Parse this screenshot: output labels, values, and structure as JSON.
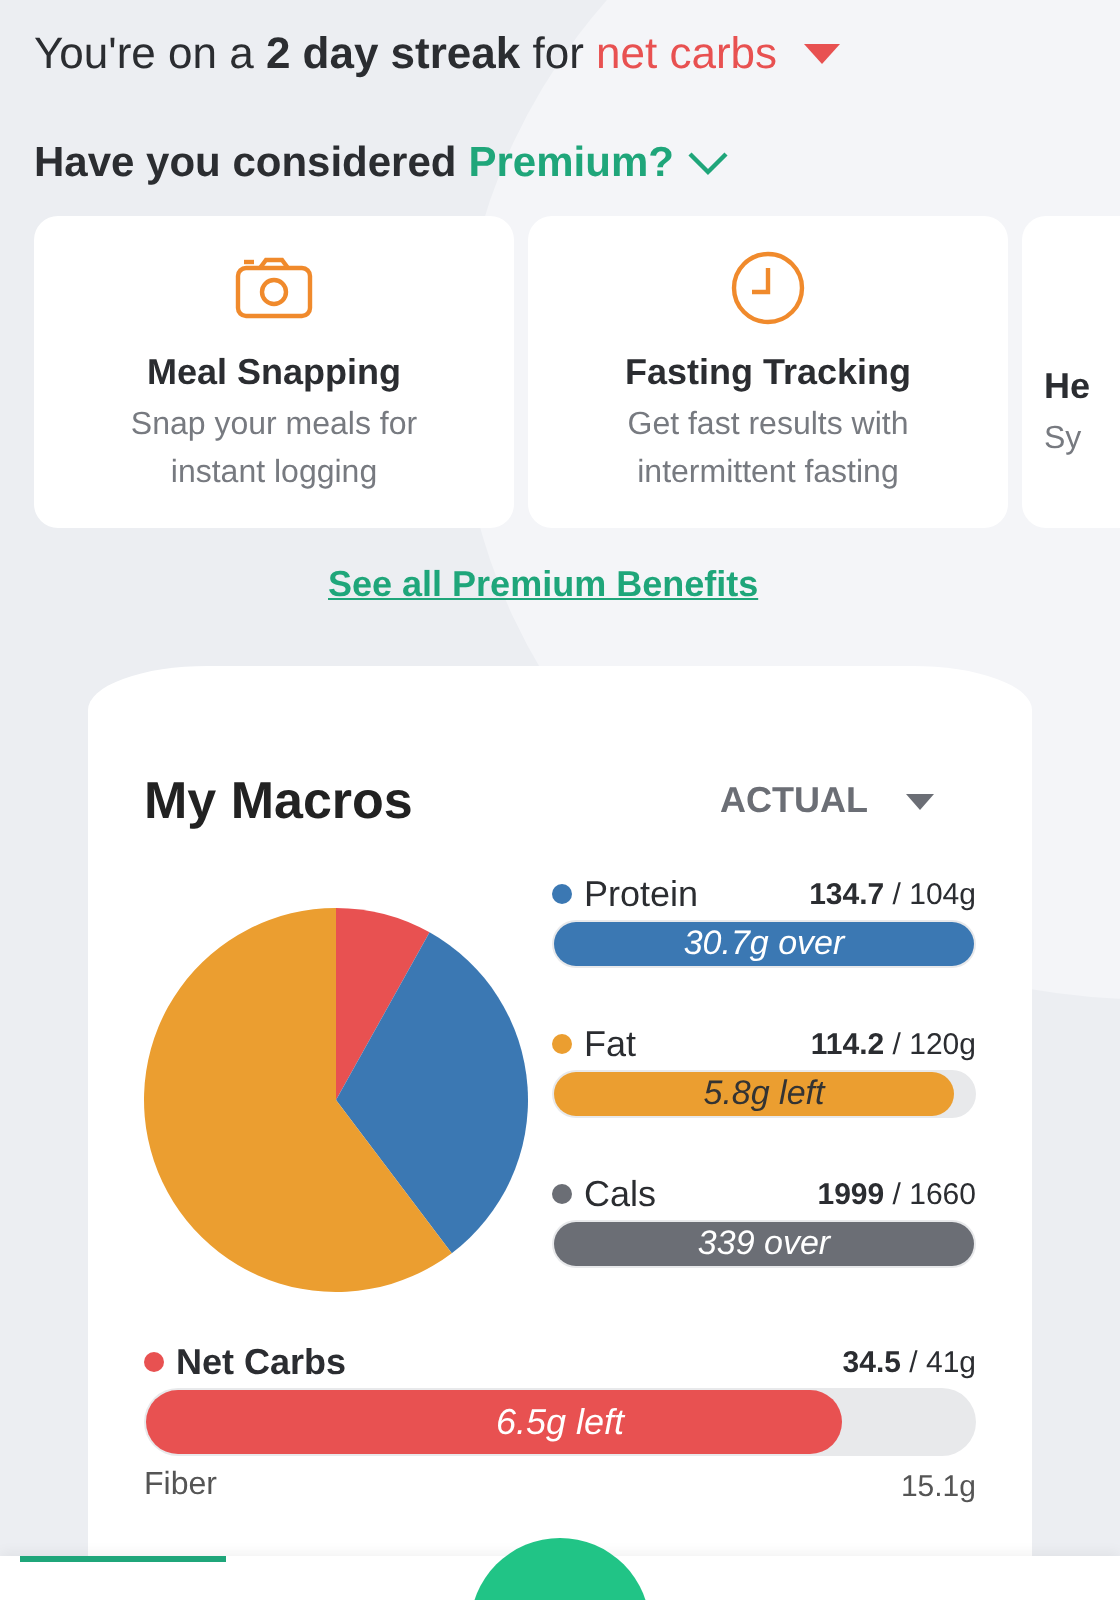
{
  "streak": {
    "text": "You're on a **2 day streak** for ",
    "metric": "net carbs"
  },
  "premium": {
    "heading": "Have you considered",
    "highlight": "Premium?"
  },
  "benefits": [
    {
      "kind": "camera",
      "title": "Meal Snapping",
      "description": "Snap your meals for instant logging"
    },
    {
      "kind": "clock",
      "title": "Fasting Tracking",
      "description": "Get fast results with intermittent fasting"
    },
    {
      "kind": "partial",
      "title": "He",
      "description": "Sy"
    }
  ],
  "benefits_link": "See all Premium Benefits",
  "macros": {
    "title": "My Macros",
    "view": "ACTUAL",
    "rows": [
      {
        "kind": "compact",
        "name": "Protein",
        "color": "#3b78b3",
        "amount": "134.7",
        "goal": "/ 104g",
        "level": 1,
        "bar_text": "30.7g over"
      },
      {
        "kind": "compact",
        "name": "Fat",
        "color": "#eb9e30",
        "amount": "114.2",
        "goal": "/ 120g",
        "level": 0.95,
        "bar_text": "5.8g left"
      },
      {
        "kind": "compact",
        "name": "Cals",
        "color": "#6b6e75",
        "amount": "1999",
        "goal": "/ 1660",
        "level": 1,
        "bar_text": "339 over"
      },
      {
        "kind": "wide",
        "name": "Net Carbs",
        "color": "#e85151",
        "amount": "34.5",
        "goal": "/ 41g",
        "level": 0.84,
        "bar_text": "6.5g left"
      },
      {
        "kind": "plain",
        "name": "Fiber",
        "amount": "15.1g"
      }
    ]
  }
}
